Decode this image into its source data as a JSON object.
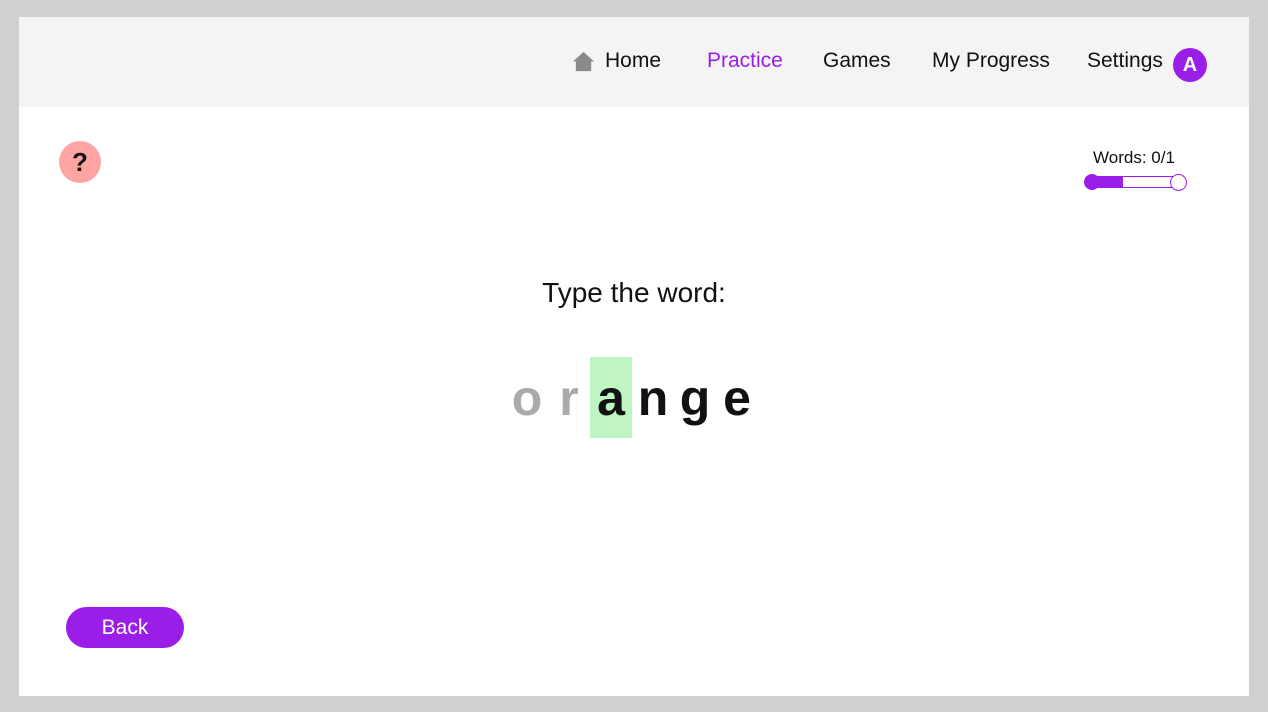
{
  "nav": {
    "home_label": "Home",
    "practice_label": "Practice",
    "games_label": "Games",
    "progress_label": "My Progress",
    "settings_label": "Settings",
    "active_item": "Practice",
    "avatar_initial": "A"
  },
  "help": {
    "label": "?"
  },
  "progress": {
    "label": "Words: 0/1",
    "completed": 0,
    "total": 1,
    "bar_fill_fraction": 0.38
  },
  "exercise": {
    "prompt": "Type the word:",
    "letters": [
      "o",
      "r",
      "a",
      "n",
      "g",
      "e"
    ],
    "current_index": 2
  },
  "footer": {
    "back_label": "Back"
  },
  "colors": {
    "accent": "#9b1ee8",
    "help_bg": "#ffa3a3",
    "current_letter_bg": "#bff5c3",
    "done_letter": "#aaaaaa",
    "navbar_bg": "#f4f4f4"
  },
  "icons": {
    "home": "home-icon"
  }
}
